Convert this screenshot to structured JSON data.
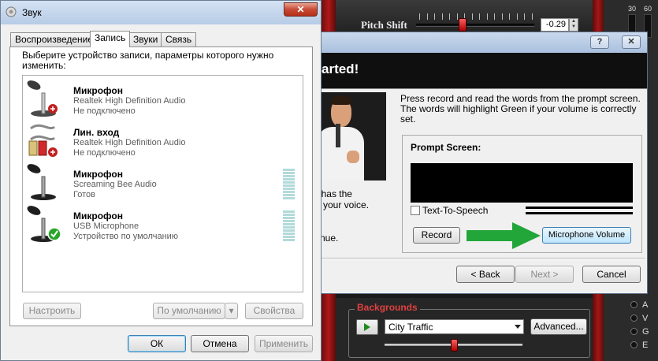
{
  "background_app": {
    "pitch": {
      "label": "Pitch Shift",
      "value": "-0.29",
      "level": 0.39
    },
    "meter_labels": [
      "30",
      "60"
    ],
    "backgrounds": {
      "title": "Backgrounds",
      "selected": "City Traffic",
      "advanced_label": "Advanced...",
      "volume_level": 0.5
    },
    "right_list_letters": [
      "A",
      "V",
      "G",
      "E"
    ]
  },
  "wizard": {
    "help_label": "?",
    "close_label": "✕",
    "heading": "arted!",
    "left_text": {
      "line1": "\" has the",
      "line2": "n your voice.",
      "line3": "tinue."
    },
    "instructions": "Press record and read the words from the prompt screen. The words will highlight Green if your volume is correctly set.",
    "prompt_label": "Prompt Screen:",
    "tts_label": "Text-To-Speech",
    "tts_checked": false,
    "record_label": "Record",
    "mic_volume_label": "Microphone Volume",
    "back_label": "< Back",
    "next_label": "Next >",
    "cancel_label": "Cancel",
    "arrow_color": "#22a63a"
  },
  "sound": {
    "title": "Звук",
    "close_label": "✕",
    "tabs": [
      "Воспроизведение",
      "Запись",
      "Звуки",
      "Связь"
    ],
    "active_tab": 1,
    "description": "Выберите устройство записи, параметры которого нужно изменить:",
    "devices": [
      {
        "name": "Микрофон",
        "driver": "Realtek High Definition Audio",
        "status": "Не подключено",
        "icon": "microphone-icon",
        "badge": "disconnected"
      },
      {
        "name": "Лин. вход",
        "driver": "Realtek High Definition Audio",
        "status": "Не подключено",
        "icon": "line-in-cable-icon",
        "badge": "disconnected"
      },
      {
        "name": "Микрофон",
        "driver": "Screaming Bee Audio",
        "status": "Готов",
        "icon": "microphone-icon",
        "badge": "none"
      },
      {
        "name": "Микрофон",
        "driver": "USB Microphone",
        "status": "Устройство по умолчанию",
        "icon": "microphone-icon",
        "badge": "default"
      }
    ],
    "configure_label": "Настроить",
    "default_label": "По умолчанию",
    "properties_label": "Свойства",
    "ok_label": "ОК",
    "cancel_label": "Отмена",
    "apply_label": "Применить"
  }
}
